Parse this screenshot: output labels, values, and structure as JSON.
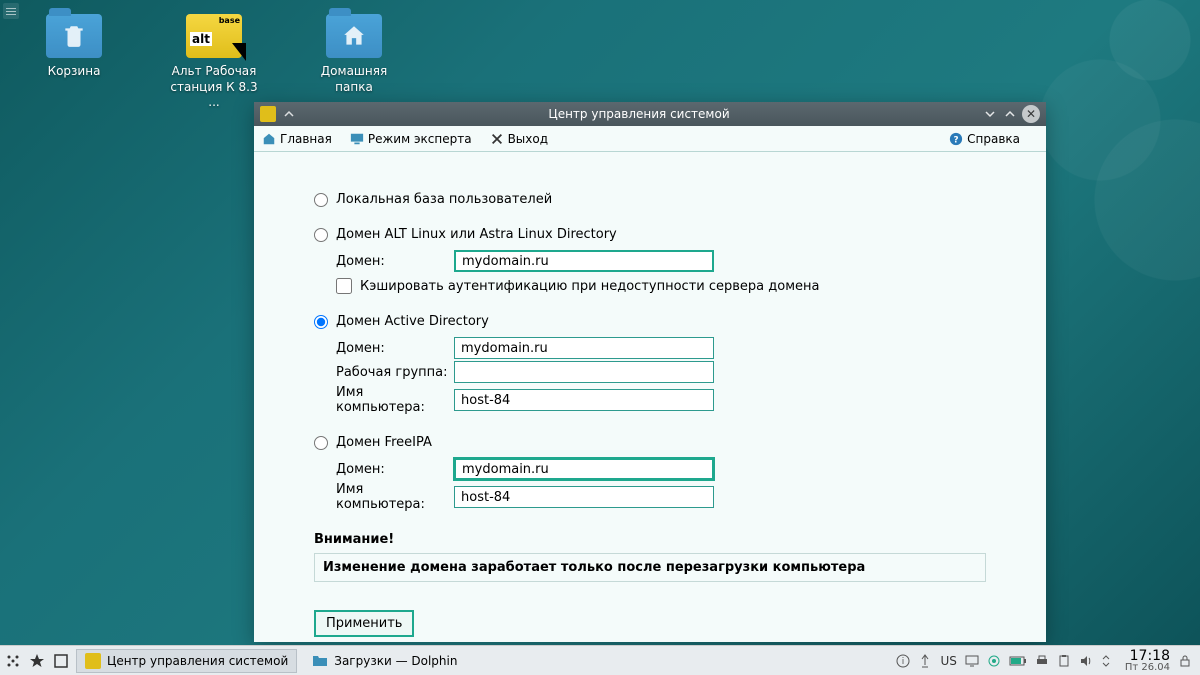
{
  "desktop": {
    "icons": {
      "trash": "Корзина",
      "alt": "Альт Рабочая станция К 8.3 ...",
      "home": "Домашняя папка"
    }
  },
  "window": {
    "title": "Центр управления системой",
    "toolbar": {
      "main": "Главная",
      "expert": "Режим эксперта",
      "exit": "Выход",
      "help": "Справка"
    },
    "opts": {
      "local": "Локальная база пользователей",
      "ald": "Домен ALT Linux или Astra Linux Directory",
      "ald_domain_label": "Домен:",
      "ald_domain_value": "mydomain.ru",
      "cache": "Кэшировать аутентификацию при недоступности сервера домена",
      "ad": "Домен Active Directory",
      "ad_domain_label": "Домен:",
      "ad_domain_value": "mydomain.ru",
      "ad_workgroup_label": "Рабочая группа:",
      "ad_workgroup_value": "",
      "ad_host_label": "Имя компьютера:",
      "ad_host_value": "host-84",
      "ipa": "Домен FreeIPA",
      "ipa_domain_label": "Домен:",
      "ipa_domain_value": "mydomain.ru",
      "ipa_host_label": "Имя компьютера:",
      "ipa_host_value": "host-84",
      "warn_label": "Внимание!",
      "warn_text": "Изменение домена заработает только после перезагрузки компьютера",
      "apply": "Применить"
    }
  },
  "taskbar": {
    "task1": "Центр управления системой",
    "task2": "Загрузки — Dolphin",
    "layout": "US",
    "time": "17:18",
    "date": "Пт 26.04"
  }
}
